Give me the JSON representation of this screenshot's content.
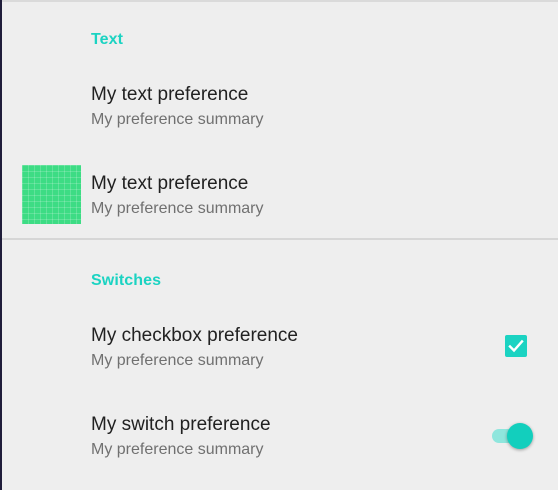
{
  "categories": {
    "text": {
      "title": "Text"
    },
    "switches": {
      "title": "Switches"
    }
  },
  "preferences": [
    {
      "title": "My text preference",
      "summary": "My preference summary"
    },
    {
      "title": "My text preference",
      "summary": "My preference summary",
      "icon": "app-icon"
    },
    {
      "title": "My checkbox preference",
      "summary": "My preference summary",
      "checked": true
    },
    {
      "title": "My switch preference",
      "summary": "My preference summary",
      "on": true
    }
  ],
  "colors": {
    "accent": "#1bd3c2",
    "background": "#eeeeee",
    "icon": "#3ddc84"
  }
}
